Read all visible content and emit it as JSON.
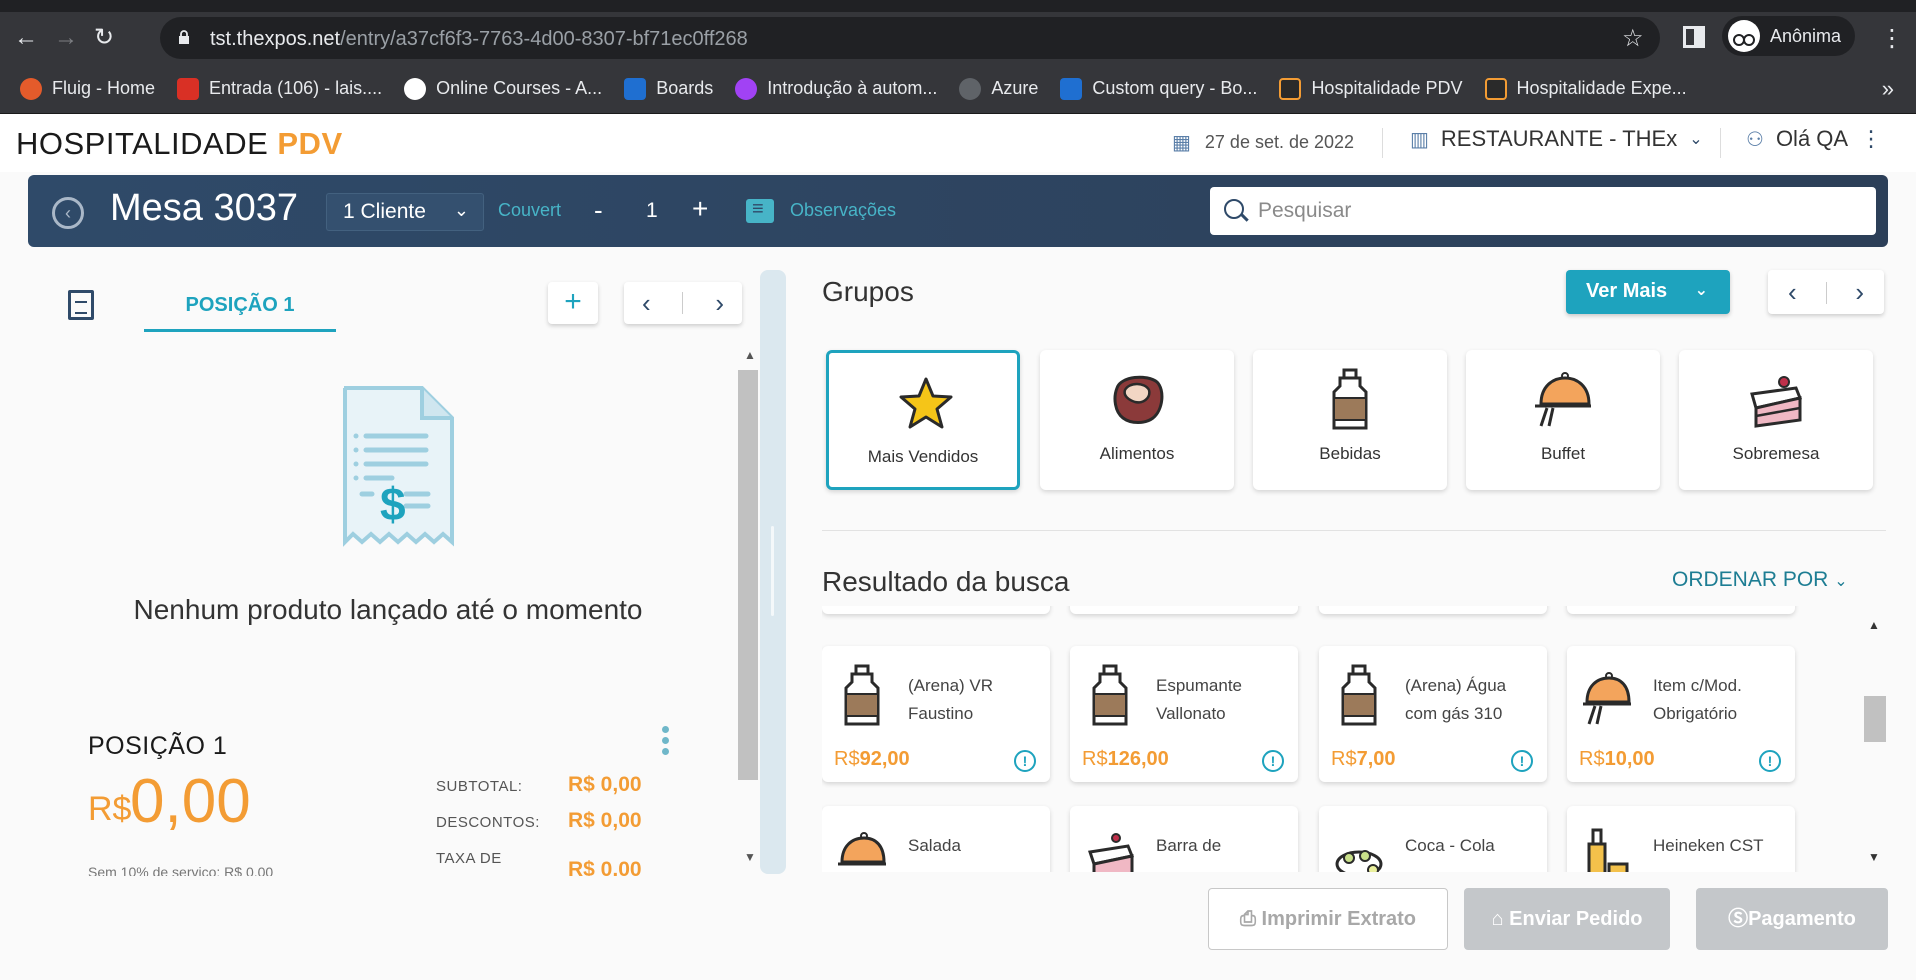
{
  "browser": {
    "url_host": "tst.thexpos.net",
    "url_path": "/entry/a37cf6f3-7763-4d00-8307-bf71ec0ff268",
    "profile_label": "Anônima",
    "bookmarks": [
      {
        "label": "Fluig - Home",
        "color": "#e45b2b"
      },
      {
        "label": "Entrada (106) - lais....",
        "color": "#d93025"
      },
      {
        "label": "Online Courses - A...",
        "color": "#ffffff"
      },
      {
        "label": "Boards",
        "color": "#1f6fd1"
      },
      {
        "label": "Introdução à autom...",
        "color": "#a142f4"
      },
      {
        "label": "Azure",
        "color": "#5f6368"
      },
      {
        "label": "Custom query - Bo...",
        "color": "#1f6fd1"
      },
      {
        "label": "Hospitalidade PDV",
        "color": "#f39c34"
      },
      {
        "label": "Hospitalidade Expe...",
        "color": "#f39c34"
      }
    ]
  },
  "header": {
    "logo_main": "HOSPITALIDADE ",
    "logo_accent": "PDV",
    "date": "27 de set. de 2022",
    "restaurant": "RESTAURANTE - THEx",
    "greeting": "Olá QA"
  },
  "mesa": {
    "title": "Mesa 3037",
    "cliente": "1 Cliente",
    "couvert_label": "Couvert",
    "couvert_minus": "-",
    "couvert_value": "1",
    "couvert_plus": "+",
    "observacoes": "Observações",
    "search_placeholder": "Pesquisar"
  },
  "left": {
    "tab_label": "POSIÇÃO 1",
    "add_label": "+",
    "empty_message": "Nenhum produto lançado até o momento",
    "summary": {
      "title": "POSIÇÃO 1",
      "currency": "R$",
      "total": "0,00",
      "subtotal_label": "SUBTOTAL:",
      "subtotal": "R$ 0,00",
      "descontos_label": "DESCONTOS:",
      "descontos": "R$ 0,00",
      "taxa_label": "TAXA DE",
      "taxa": "R$ 0,00",
      "sem_note": "Sem 10% de serviço: R$ 0,00"
    }
  },
  "groups": {
    "title": "Grupos",
    "ver_mais": "Ver Mais",
    "items": [
      {
        "label": "Mais Vendidos",
        "icon": "star-icon",
        "selected": true
      },
      {
        "label": "Alimentos",
        "icon": "steak-icon",
        "selected": false
      },
      {
        "label": "Bebidas",
        "icon": "bottle-icon",
        "selected": false
      },
      {
        "label": "Buffet",
        "icon": "cloche-icon",
        "selected": false
      },
      {
        "label": "Sobremesa",
        "icon": "cake-icon",
        "selected": false
      }
    ]
  },
  "results": {
    "title": "Resultado da busca",
    "ordenar": "ORDENAR POR",
    "products": [
      {
        "name": "(Arena) VR Faustino",
        "currency": "R$",
        "price": "92,00",
        "icon": "bottle-icon"
      },
      {
        "name": "Espumante Vallonato",
        "currency": "R$",
        "price": "126,00",
        "icon": "bottle-icon"
      },
      {
        "name": "(Arena) Água com gás 310",
        "currency": "R$",
        "price": "7,00",
        "icon": "bottle-icon"
      },
      {
        "name": "Item c/Mod. Obrigatório",
        "currency": "R$",
        "price": "10,00",
        "icon": "cloche-icon"
      },
      {
        "name": "Salada",
        "currency": "",
        "price": "",
        "icon": "cloche-icon"
      },
      {
        "name": "Barra de",
        "currency": "",
        "price": "",
        "icon": "cake-icon"
      },
      {
        "name": "Coca - Cola",
        "currency": "",
        "price": "",
        "icon": "salad-icon"
      },
      {
        "name": "Heineken CST",
        "currency": "",
        "price": "",
        "icon": "beer-icon"
      }
    ]
  },
  "footer": {
    "imprimir": "Imprimir Extrato",
    "enviar": "Enviar Pedido",
    "pagamento": "Pagamento"
  },
  "colors": {
    "accent_teal": "#1ea3be",
    "accent_orange": "#f39c34",
    "mesa_bar": "#2f4a69"
  }
}
